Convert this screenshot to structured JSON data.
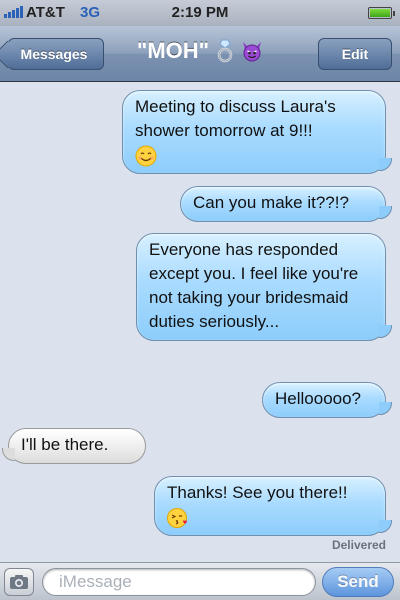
{
  "status_bar": {
    "carrier": "AT&T",
    "network": "3G",
    "time": "2:19 PM",
    "signal_bars": 5,
    "battery_level": 1.0
  },
  "nav": {
    "back_label": "Messages",
    "title": "\"MOH\"",
    "title_icons": [
      "ring-icon",
      "devil-icon"
    ],
    "edit_label": "Edit"
  },
  "messages": [
    {
      "direction": "sent",
      "text": "Meeting to discuss Laura's shower tomorrow at 9!!!",
      "emoji": "smile-icon"
    },
    {
      "direction": "sent",
      "text": "Can you make it??!?"
    },
    {
      "direction": "sent",
      "text": "Everyone has responded except you. I feel like you're not taking your bridesmaid duties seriously..."
    },
    {
      "direction": "sent",
      "text": "Hellooooo?"
    },
    {
      "direction": "received",
      "text": "I'll be there."
    },
    {
      "direction": "sent",
      "text": "Thanks! See you there!!",
      "emoji": "kiss-icon"
    }
  ],
  "delivered_label": "Delivered",
  "composer": {
    "placeholder": "iMessage",
    "value": "",
    "send_label": "Send"
  },
  "colors": {
    "sent_bubble": "#a9dbff",
    "received_bubble": "#efefef",
    "nav_bar": "#7c92b1",
    "background": "#dbe2ed"
  }
}
